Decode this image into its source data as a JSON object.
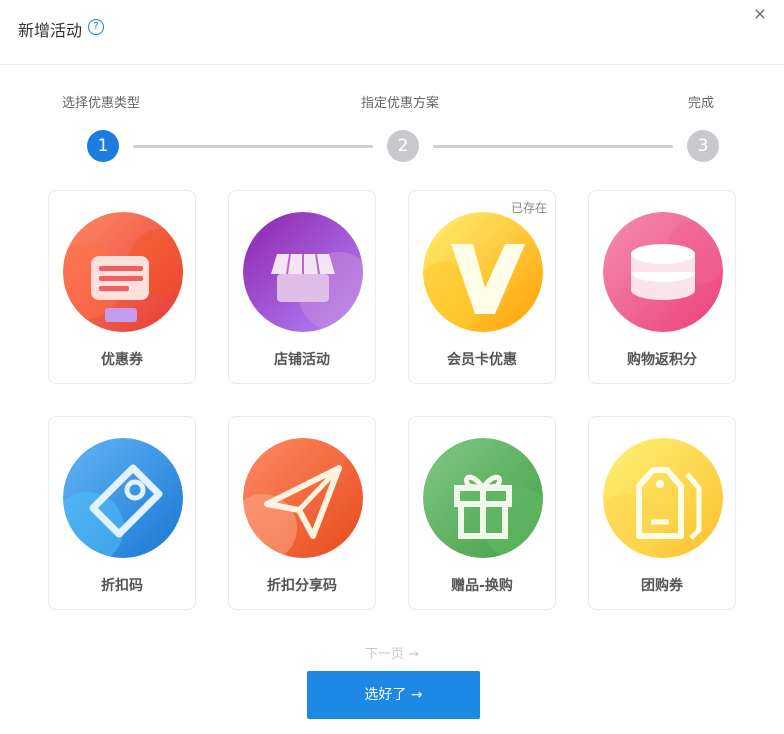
{
  "dialog": {
    "title": "新增活动",
    "help_icon": "question-circle-icon",
    "close_icon": "close-icon",
    "close_glyph": "×",
    "help_glyph": "?"
  },
  "steps": [
    {
      "label": "选择优惠类型",
      "number": "1",
      "active": true
    },
    {
      "label": "指定优惠方案",
      "number": "2",
      "active": false
    },
    {
      "label": "完成",
      "number": "3",
      "active": false
    }
  ],
  "colors": {
    "accent": "#1e88e5",
    "step_active": "#1d7ce0",
    "step_inactive": "#c8c9cc"
  },
  "cards": [
    {
      "label": "优惠券",
      "icon": "coupon-icon",
      "badge": ""
    },
    {
      "label": "店铺活动",
      "icon": "store-icon",
      "badge": ""
    },
    {
      "label": "会员卡优惠",
      "icon": "vip-card-icon",
      "badge": "已存在"
    },
    {
      "label": "购物返积分",
      "icon": "points-coins-icon",
      "badge": ""
    },
    {
      "label": "折扣码",
      "icon": "discount-tag-icon",
      "badge": ""
    },
    {
      "label": "折扣分享码",
      "icon": "share-plane-icon",
      "badge": ""
    },
    {
      "label": "赠品-换购",
      "icon": "gift-icon",
      "badge": ""
    },
    {
      "label": "团购券",
      "icon": "group-tag-icon",
      "badge": ""
    }
  ],
  "footer": {
    "next_page": "下一页 →",
    "confirm": "选好了 →"
  }
}
